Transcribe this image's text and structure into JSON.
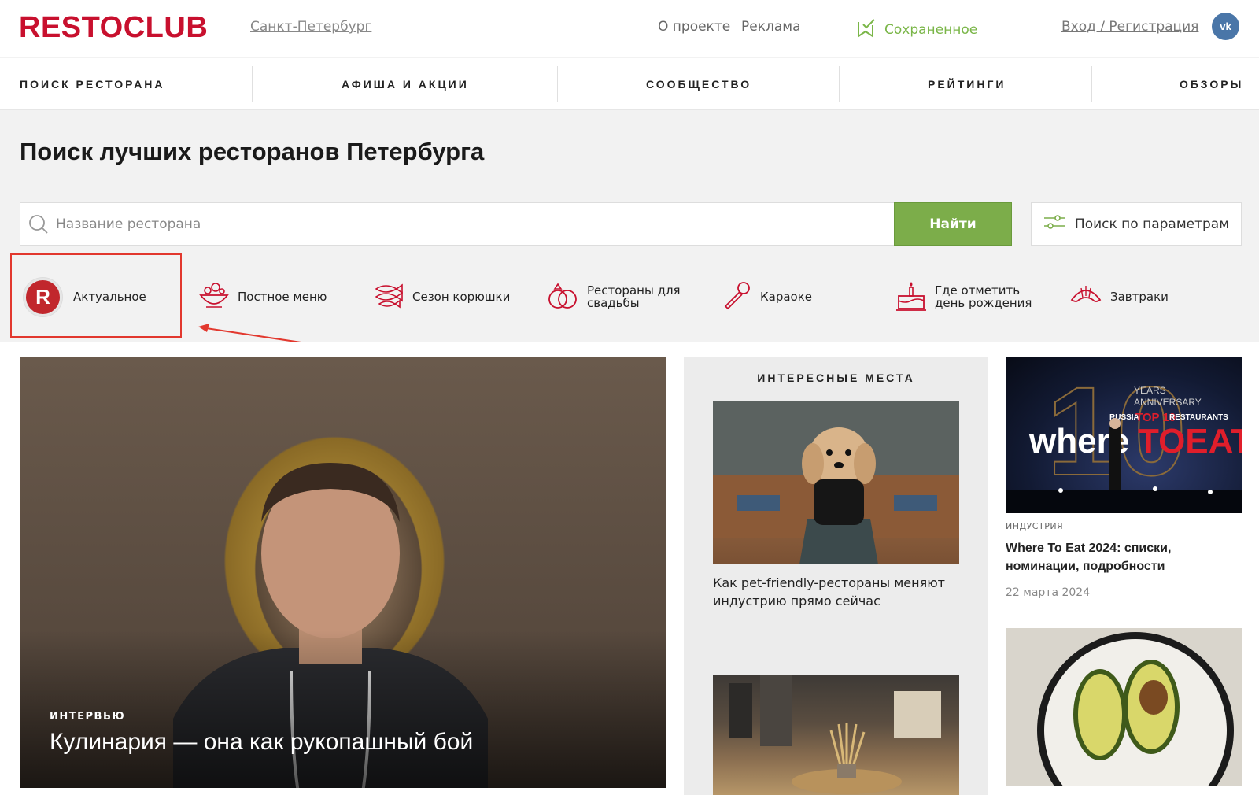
{
  "header": {
    "logo": "RESTOCLUB",
    "city": "Санкт-Петербург",
    "about": "О проекте",
    "ads": "Реклама",
    "saved": "Сохраненное",
    "login": "Вход / Регистрация",
    "vk": "vk",
    "accent_color": "#c8102e",
    "saved_color": "#7ab648"
  },
  "nav": {
    "items": [
      {
        "label": "ПОИСК РЕСТОРАНА"
      },
      {
        "label": "АФИША И АКЦИИ"
      },
      {
        "label": "СООБЩЕСТВО"
      },
      {
        "label": "РЕЙТИНГИ"
      },
      {
        "label": "ОБЗОРЫ"
      }
    ]
  },
  "search": {
    "title": "Поиск лучших ресторанов Петербурга",
    "placeholder": "Название ресторана",
    "find_label": "Найти",
    "params_label": "Поиск по параметрам"
  },
  "categories": [
    {
      "label": "Актуальное",
      "icon": "restoclub-r-icon"
    },
    {
      "label": "Постное меню",
      "icon": "salad-bowl-icon"
    },
    {
      "label": "Сезон корюшки",
      "icon": "fish-icon"
    },
    {
      "label": "Рестораны для свадьбы",
      "icon": "wedding-rings-icon"
    },
    {
      "label": "Караоке",
      "icon": "microphone-icon"
    },
    {
      "label": "Где отметить день рождения",
      "icon": "birthday-cake-icon"
    },
    {
      "label": "Завтраки",
      "icon": "croissant-icon"
    }
  ],
  "hero": {
    "tag": "ИНТЕРВЬЮ",
    "title": "Кулинария — она как рукопашный бой"
  },
  "interesting": {
    "title": "ИНТЕРЕСНЫЕ МЕСТА",
    "items": [
      {
        "caption": "Как pet-friendly-рестораны меняют индустрию прямо сейчас"
      }
    ]
  },
  "right_articles": [
    {
      "tag": "ИНДУСТРИЯ",
      "title": "Where To Eat 2024: списки, номинации, подробности",
      "date": "22 марта 2024",
      "image_text": {
        "years": "YEARS",
        "anniversary": "ANNIVERSARY",
        "russia": "RUSSIA",
        "top10": "TOP 10",
        "restaurants": "RESTAURANTS",
        "ten": "10",
        "where": "where",
        "toeat": "TOEAT"
      }
    }
  ]
}
